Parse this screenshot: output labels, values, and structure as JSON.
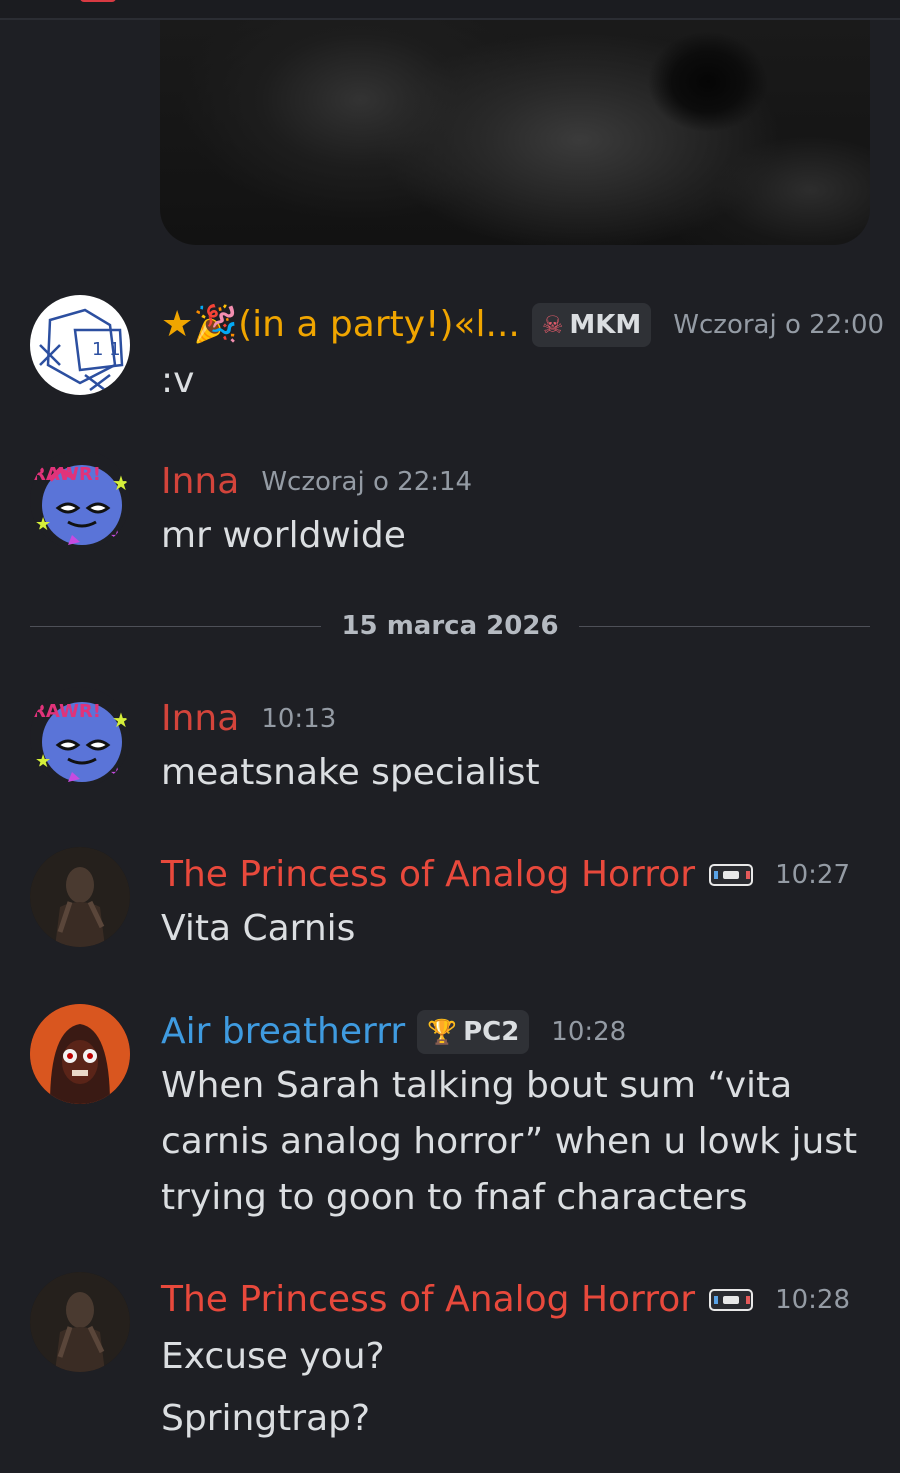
{
  "colors": {
    "background": "#1e1f24",
    "name_orange": "#f0a500",
    "name_inna": "#d3443b",
    "name_princess": "#e8493c",
    "name_air": "#3f9be0",
    "timestamp": "#949ba4"
  },
  "divider": {
    "date": "15 marca 2026"
  },
  "messages": [
    {
      "author": "★🎉(in a party!)«l...",
      "tag": {
        "icon": "skull-icon",
        "text": "MKM"
      },
      "time": "Wczoraj o 22:00",
      "lines": [
        ":v"
      ]
    },
    {
      "author": "Inna",
      "time": "Wczoraj o 22:14",
      "lines": [
        "mr worldwide"
      ]
    },
    {
      "author": "Inna",
      "time": "10:13",
      "lines": [
        "meatsnake specialist"
      ]
    },
    {
      "author": "The Princess of Analog Horror",
      "badge_icon": "vhs-tape-icon",
      "time": "10:27",
      "lines": [
        "Vita Carnis"
      ]
    },
    {
      "author": "Air breatherrr",
      "tag": {
        "icon": "trophy-icon",
        "text": "PC2"
      },
      "time": "10:28",
      "lines": [
        "When Sarah talking bout sum “vita",
        "carnis analog horror” when u lowk just",
        "trying to goon to fnaf characters"
      ]
    },
    {
      "author": "The Princess of Analog Horror",
      "badge_icon": "vhs-tape-icon",
      "time": "10:28",
      "lines": [
        "Excuse you?",
        "Springtrap?"
      ]
    }
  ]
}
